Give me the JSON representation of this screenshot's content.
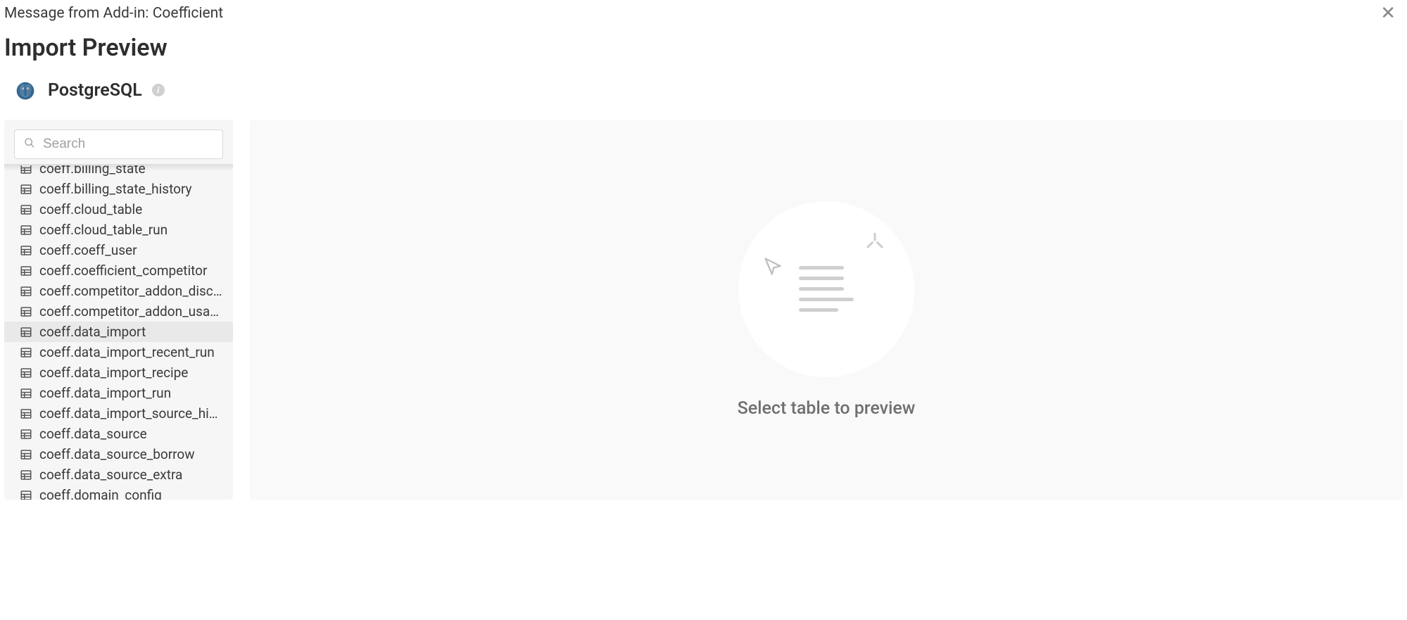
{
  "topbar": {
    "message": "Message from Add-in: Coefficient"
  },
  "page": {
    "title": "Import Preview"
  },
  "source": {
    "name": "PostgreSQL"
  },
  "search": {
    "placeholder": "Search",
    "value": ""
  },
  "tables": [
    {
      "name": "coeff.billing_state",
      "selected": false,
      "partial": true
    },
    {
      "name": "coeff.billing_state_history",
      "selected": false
    },
    {
      "name": "coeff.cloud_table",
      "selected": false
    },
    {
      "name": "coeff.cloud_table_run",
      "selected": false
    },
    {
      "name": "coeff.coeff_user",
      "selected": false
    },
    {
      "name": "coeff.coefficient_competitor",
      "selected": false
    },
    {
      "name": "coeff.competitor_addon_discov…",
      "selected": false
    },
    {
      "name": "coeff.competitor_addon_usage",
      "selected": false
    },
    {
      "name": "coeff.data_import",
      "selected": true
    },
    {
      "name": "coeff.data_import_recent_run",
      "selected": false
    },
    {
      "name": "coeff.data_import_recipe",
      "selected": false
    },
    {
      "name": "coeff.data_import_run",
      "selected": false
    },
    {
      "name": "coeff.data_import_source_histo…",
      "selected": false
    },
    {
      "name": "coeff.data_source",
      "selected": false
    },
    {
      "name": "coeff.data_source_borrow",
      "selected": false
    },
    {
      "name": "coeff.data_source_extra",
      "selected": false
    },
    {
      "name": "coeff.domain_config",
      "selected": false,
      "partial_bottom": true
    }
  ],
  "preview": {
    "empty_message": "Select table to preview"
  }
}
